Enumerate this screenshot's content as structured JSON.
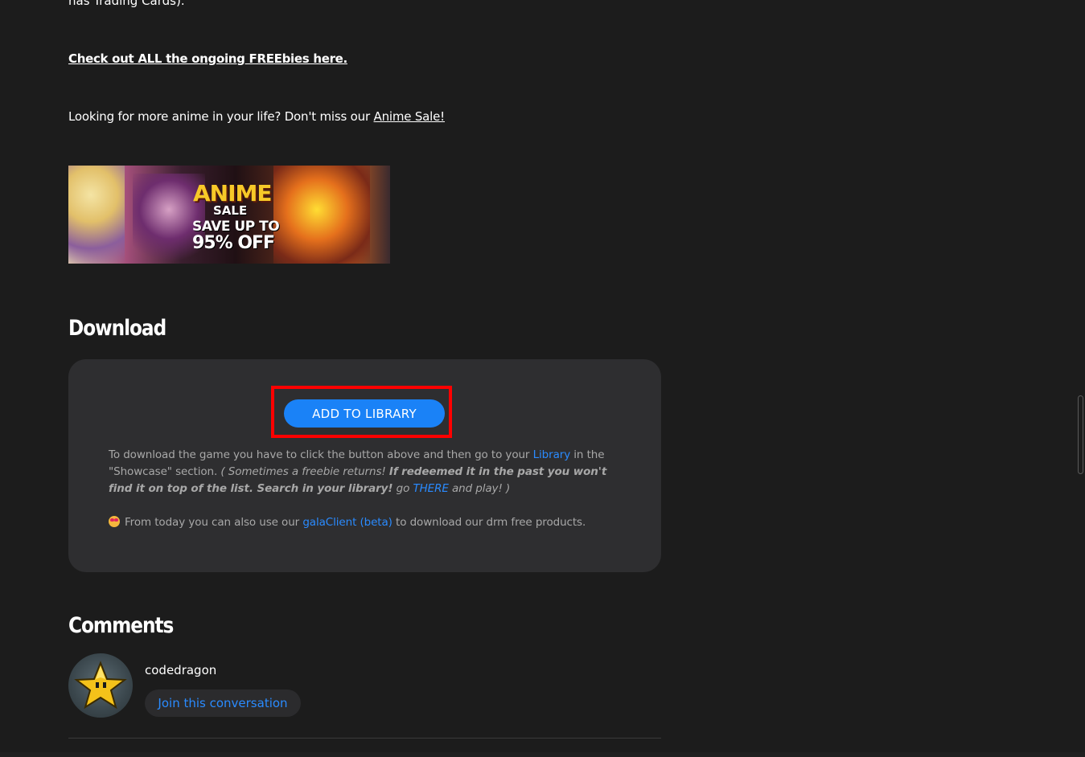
{
  "article": {
    "cut_text": "has Trading Cards).",
    "freebies_link": "Check out ALL the ongoing FREEbies here.",
    "anime_prefix": "Looking for more anime in your life? Don't miss our ",
    "anime_link": "Anime Sale!",
    "banner": {
      "anime": "ANIME",
      "sale": "SALE",
      "save": "SAVE UP TO",
      "off": "95% OFF"
    }
  },
  "download": {
    "heading": "Download",
    "button_label": "ADD TO LIBRARY",
    "text_1": "To download the game you have to click the button above and then go to your ",
    "library_link": "Library",
    "text_2": " in the \"Showcase\" section. ",
    "italic_1": "( Sometimes a freebie returns! ",
    "bold_italic": "If redeemed it in the past you won't find it on top of the list. Search in your library!",
    "italic_2": " go ",
    "there_link": "THERE",
    "italic_3": " and play! )",
    "client_prefix": "From today you can also use our ",
    "client_link": "galaClient (beta)",
    "client_suffix": " to download our drm free products."
  },
  "comments": {
    "heading": "Comments",
    "username": "codedragon",
    "join_label": "Join this conversation"
  },
  "icons": {
    "emoji": "heart-eyes-emoji-icon",
    "avatar": "star-avatar-icon"
  },
  "colors": {
    "background": "#1c1c1c",
    "panel": "#2e2e30",
    "accent_blue": "#1a82f7",
    "link_blue": "#2a8bff",
    "highlight_red": "#ff0000"
  }
}
